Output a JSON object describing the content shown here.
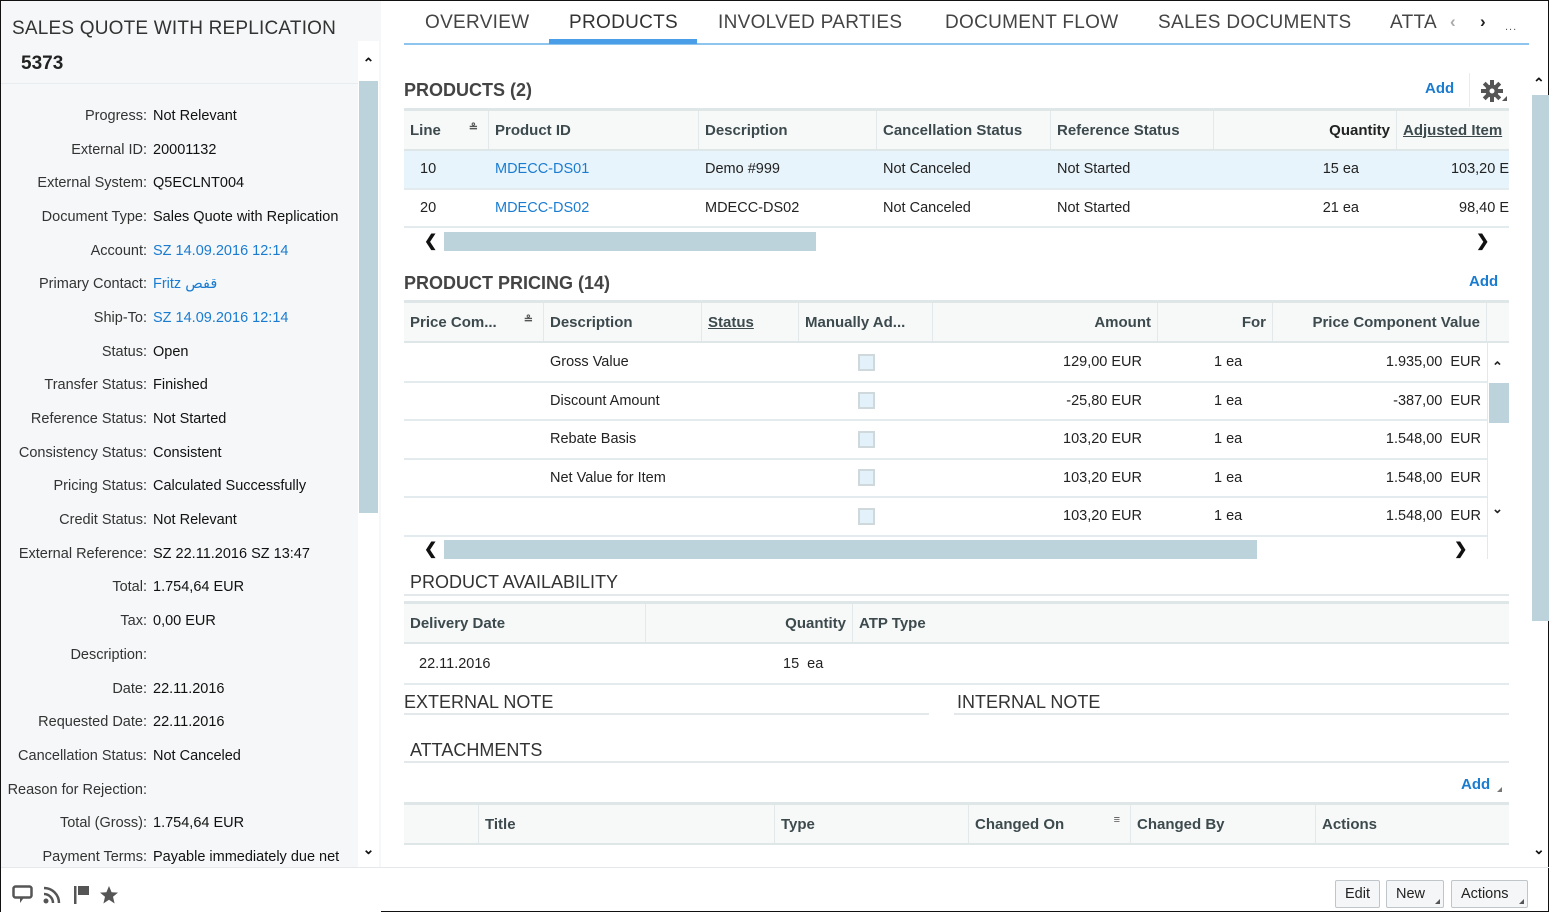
{
  "header": {
    "title": "SALES QUOTE WITH REPLICATION",
    "id": "5373"
  },
  "fields": [
    {
      "label": "Progress:",
      "value": "Not Relevant",
      "link": false
    },
    {
      "label": "External ID:",
      "value": "20001132",
      "link": false
    },
    {
      "label": "External System:",
      "value": "Q5ECLNT004",
      "link": false
    },
    {
      "label": "Document Type:",
      "value": "Sales Quote with Replication",
      "link": false
    },
    {
      "label": "Account:",
      "value": "SZ 14.09.2016 12:14",
      "link": true
    },
    {
      "label": "Primary Contact:",
      "value": "Fritz قفص",
      "link": true
    },
    {
      "label": "Ship-To:",
      "value": "SZ 14.09.2016 12:14",
      "link": true
    },
    {
      "label": "Status:",
      "value": "Open",
      "link": false
    },
    {
      "label": "Transfer Status:",
      "value": "Finished",
      "link": false
    },
    {
      "label": "Reference Status:",
      "value": "Not Started",
      "link": false
    },
    {
      "label": "Consistency Status:",
      "value": "Consistent",
      "link": false
    },
    {
      "label": "Pricing Status:",
      "value": "Calculated Successfully",
      "link": false
    },
    {
      "label": "Credit Status:",
      "value": "Not Relevant",
      "link": false
    },
    {
      "label": "External Reference:",
      "value": "SZ 22.11.2016 SZ 13:47",
      "link": false
    },
    {
      "label": "Total:",
      "value": "1.754,64 EUR",
      "link": false
    },
    {
      "label": "Tax:",
      "value": "0,00 EUR",
      "link": false
    },
    {
      "label": "Description:",
      "value": "",
      "link": false
    },
    {
      "label": "Date:",
      "value": "22.11.2016",
      "link": false
    },
    {
      "label": "Requested Date:",
      "value": "22.11.2016",
      "link": false
    },
    {
      "label": "Cancellation Status:",
      "value": "Not Canceled",
      "link": false
    },
    {
      "label": "Reason for Rejection:",
      "value": "",
      "link": false
    },
    {
      "label": "Total (Gross):",
      "value": "1.754,64 EUR",
      "link": false
    },
    {
      "label": "Payment Terms:",
      "value": "Payable immediately due net",
      "link": false
    }
  ],
  "footer_icons": [
    "feed-comment-icon",
    "rss-icon",
    "flag-icon",
    "star-icon"
  ],
  "tabs": [
    {
      "label": "OVERVIEW",
      "active": false
    },
    {
      "label": "PRODUCTS",
      "active": true
    },
    {
      "label": "INVOLVED PARTIES",
      "active": false
    },
    {
      "label": "DOCUMENT FLOW",
      "active": false
    },
    {
      "label": "SALES DOCUMENTS",
      "active": false
    },
    {
      "label": "ATTA",
      "active": false
    }
  ],
  "tab_more": "...",
  "products": {
    "title": "PRODUCTS (2)",
    "add_label": "Add",
    "columns": [
      "Line",
      "Product ID",
      "Description",
      "Cancellation Status",
      "Reference Status",
      "Quantity",
      "Adjusted Item"
    ],
    "rows": [
      {
        "line": "10",
        "product_id": "MDECC-DS01",
        "description": "Demo #999",
        "cancellation": "Not Canceled",
        "reference": "Not Started",
        "quantity": "15 ea",
        "adjusted": "103,20 E",
        "selected": true
      },
      {
        "line": "20",
        "product_id": "MDECC-DS02",
        "description": "MDECC-DS02",
        "cancellation": "Not Canceled",
        "reference": "Not Started",
        "quantity": "21 ea",
        "adjusted": "98,40 E",
        "selected": false
      }
    ]
  },
  "pricing": {
    "title": "PRODUCT PRICING (14)",
    "add_label": "Add",
    "columns": [
      "Price Com...",
      "Description",
      "Status",
      "Manually Ad...",
      "Amount",
      "For",
      "Price Component Value"
    ],
    "rows": [
      {
        "component": "",
        "description": "Gross Value",
        "status": "",
        "manual": false,
        "amount": "129,00 EUR",
        "for": "1 ea",
        "value": "1.935,00  EUR"
      },
      {
        "component": "",
        "description": "Discount Amount",
        "status": "",
        "manual": false,
        "amount": "-25,80 EUR",
        "for": "1 ea",
        "value": "-387,00  EUR"
      },
      {
        "component": "",
        "description": "Rebate Basis",
        "status": "",
        "manual": false,
        "amount": "103,20 EUR",
        "for": "1 ea",
        "value": "1.548,00  EUR"
      },
      {
        "component": "",
        "description": "Net Value for Item",
        "status": "",
        "manual": false,
        "amount": "103,20 EUR",
        "for": "1 ea",
        "value": "1.548,00  EUR"
      },
      {
        "component": "",
        "description": "",
        "status": "",
        "manual": false,
        "amount": "103,20 EUR",
        "for": "1 ea",
        "value": "1.548,00  EUR"
      }
    ]
  },
  "availability": {
    "title": "PRODUCT AVAILABILITY",
    "columns": [
      "Delivery Date",
      "Quantity",
      "ATP Type"
    ],
    "rows": [
      {
        "date": "22.11.2016",
        "quantity": "15  ea",
        "atp": ""
      }
    ]
  },
  "external_note": {
    "title": "EXTERNAL NOTE"
  },
  "internal_note": {
    "title": "INTERNAL NOTE"
  },
  "attachments": {
    "title": "ATTACHMENTS",
    "add_label": "Add",
    "columns": [
      "",
      "Title",
      "Type",
      "Changed On",
      "Changed By",
      "Actions"
    ]
  },
  "actions": {
    "edit": "Edit",
    "new": "New",
    "actions": "Actions"
  },
  "colors": {
    "accent": "#4a9ee8",
    "link": "#1a7cd1",
    "scrollbar": "#bcd3dc",
    "selected_row": "#e8f4fb"
  }
}
